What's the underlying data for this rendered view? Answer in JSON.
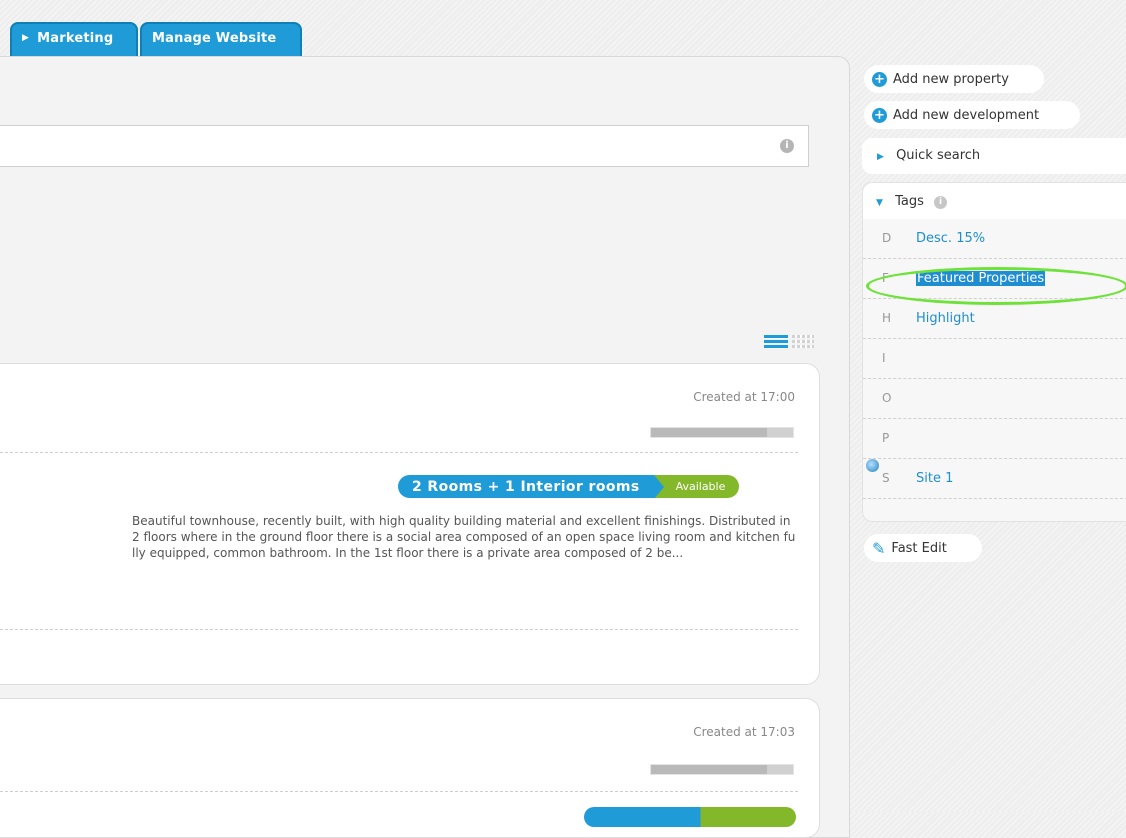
{
  "tabs": [
    {
      "label": "Marketing",
      "icon": "triangle-right-icon"
    },
    {
      "label": "Manage Website"
    }
  ],
  "search": {
    "value": "",
    "info_icon": "i"
  },
  "view_toggle": {
    "list_icon": "list-view-icon",
    "grid_icon": "grid-view-icon",
    "active": "list"
  },
  "listings": [
    {
      "created": "Created at 17:00",
      "progress": 0.82,
      "rooms": "2 Rooms + 1 Interior rooms",
      "status": "Available",
      "description": "Beautiful townhouse, recently built, with high quality building material and excellent finishings. Distributed in 2 floors where in the ground floor there is a social area composed of an open space living room and kitchen fully equipped, common bathroom. In the 1st floor there is a private area composed of 2 be..."
    },
    {
      "created": "Created at 17:03",
      "progress": 0.82
    }
  ],
  "sidebar": {
    "add_property": "Add new property",
    "add_development": "Add new development",
    "quick_search": "Quick search",
    "tags_title": "Tags",
    "tags": [
      {
        "letter": "D",
        "name": "Desc. 15%"
      },
      {
        "letter": "F",
        "name": "Featured Properties",
        "selected": true
      },
      {
        "letter": "H",
        "name": "Highlight"
      },
      {
        "letter": "I",
        "name": ""
      },
      {
        "letter": "O",
        "name": ""
      },
      {
        "letter": "P",
        "name": ""
      },
      {
        "letter": "S",
        "name": "Site 1"
      }
    ],
    "fast_edit": "Fast Edit"
  },
  "colors": {
    "accent": "#1f9cd8",
    "available": "#84b82b",
    "highlight_ring": "#6fe23a"
  }
}
